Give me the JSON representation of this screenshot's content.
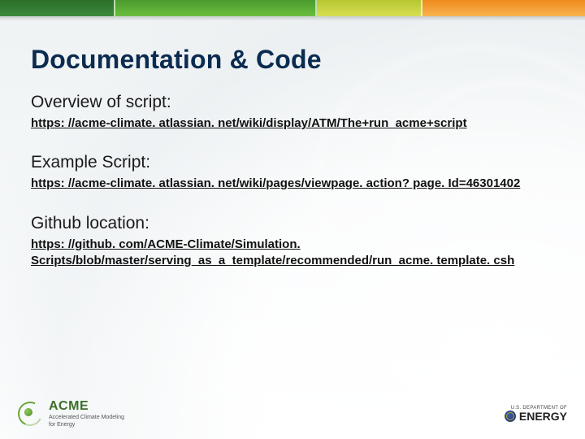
{
  "slide": {
    "title": "Documentation & Code",
    "sections": [
      {
        "heading": "Overview of script:",
        "link": "https: //acme-climate. atlassian. net/wiki/display/ATM/The+run_acme+script"
      },
      {
        "heading": "Example Script:",
        "link": "https: //acme-climate. atlassian. net/wiki/pages/viewpage. action? page. Id=46301402"
      },
      {
        "heading": "Github location:",
        "link": "https: //github. com/ACME-Climate/Simulation. Scripts/blob/master/serving_as_a_template/recommended/run_acme. template. csh"
      }
    ]
  },
  "footer": {
    "left": {
      "word": "ACME",
      "tagline1": "Accelerated Climate Modeling",
      "tagline2": "for Energy"
    },
    "right": {
      "small": "U.S. DEPARTMENT OF",
      "word": "ENERGY"
    }
  }
}
